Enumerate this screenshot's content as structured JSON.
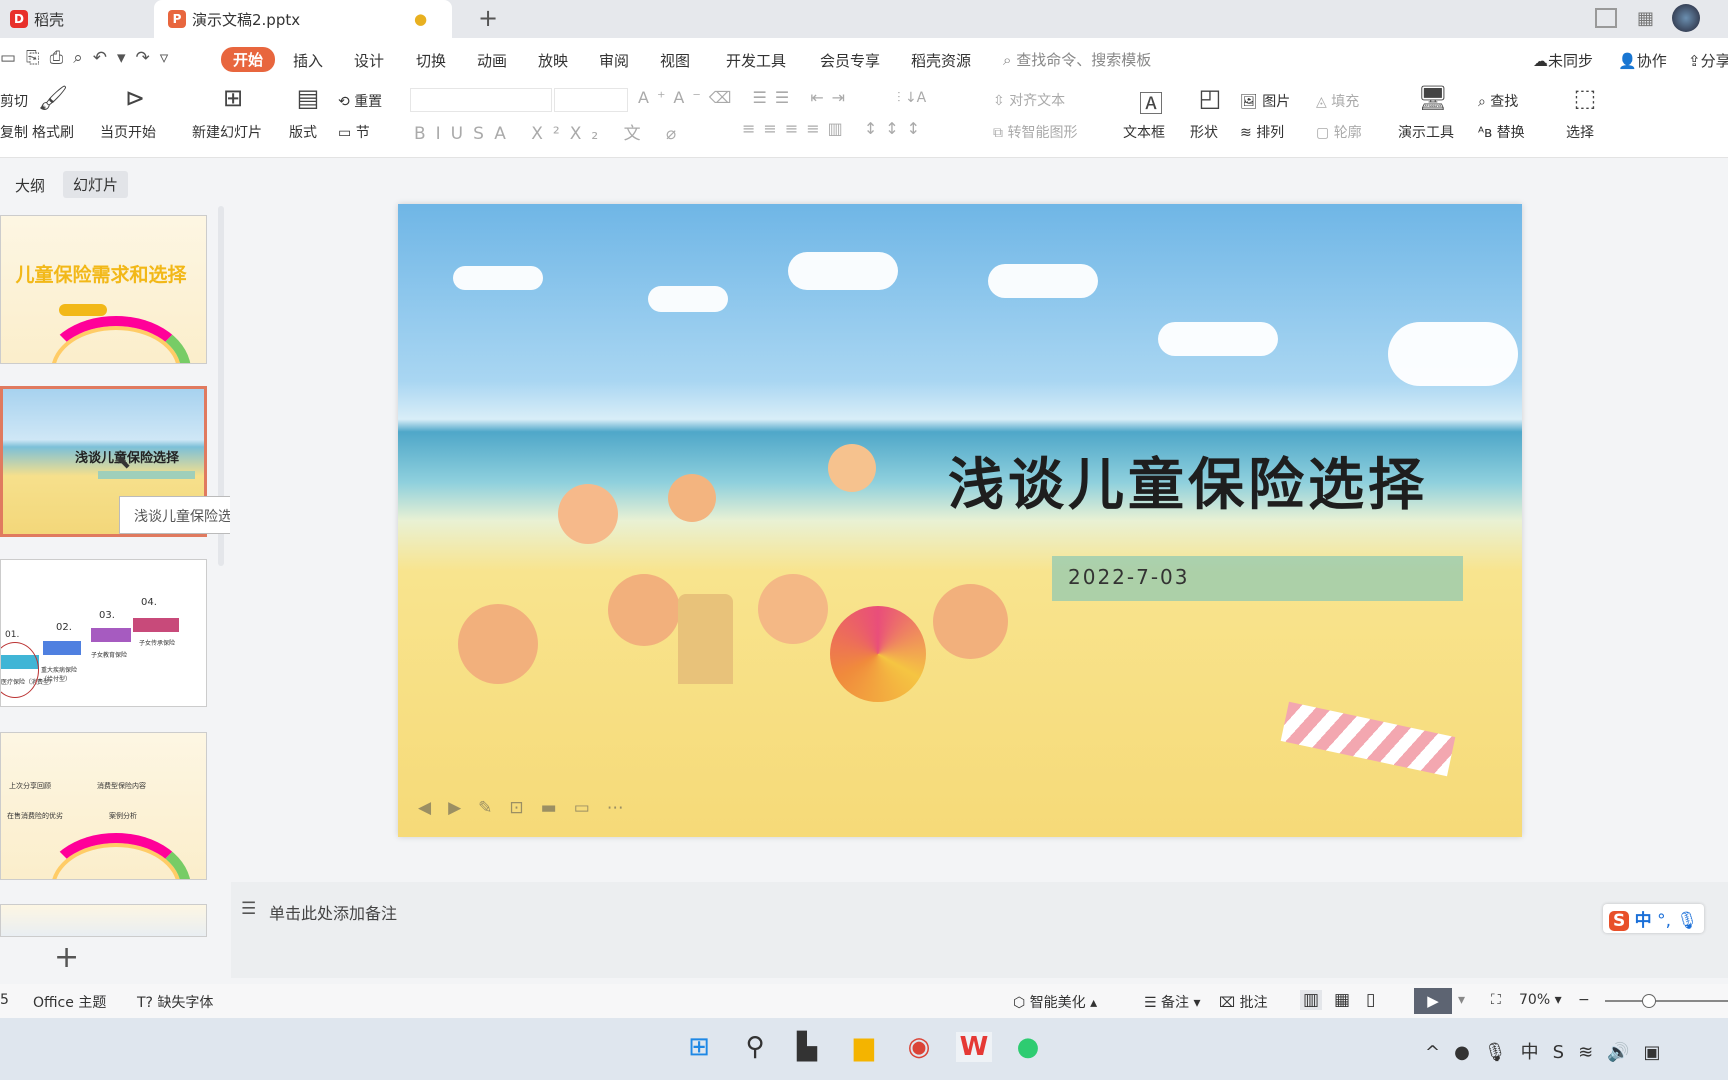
{
  "tabs": [
    {
      "label": "稻壳",
      "icon": "daoke-logo-icon"
    },
    {
      "label": "演示文稿2.pptx",
      "icon": "ppt-file-icon",
      "active": true
    }
  ],
  "menu": {
    "items": [
      "开始",
      "插入",
      "设计",
      "切换",
      "动画",
      "放映",
      "审阅",
      "视图",
      "开发工具",
      "会员专享",
      "稻壳资源"
    ],
    "active": "开始",
    "search_placeholder": "查找命令、搜索模板",
    "sync": "未同步",
    "collab": "协作",
    "share": "分享"
  },
  "ribbon": {
    "cut": "剪切",
    "copy": "复制",
    "format_painter": "格式刷",
    "play_from_current": "当页开始",
    "new_slide": "新建幻灯片",
    "layout": "版式",
    "reset": "重置",
    "section": "节",
    "align_text": "对齐文本",
    "smart_art": "转智能图形",
    "textbox": "文本框",
    "shape": "形状",
    "picture": "图片",
    "fill": "填充",
    "arrange": "排列",
    "outline": "轮廓",
    "present_tools": "演示工具",
    "find": "查找",
    "replace": "替换",
    "select": "选择"
  },
  "panel": {
    "tab_outline": "大纲",
    "tab_slides": "幻灯片",
    "tooltip": "浅谈儿童保险选择",
    "thumb1_title": "儿童保险需求和选择",
    "thumb2_title": "浅谈儿童保险选择",
    "thumb3_labels": [
      "01.",
      "02.",
      "03.",
      "04."
    ],
    "thumb3_captions": [
      "医疗保险（消费型）",
      "重大疾病保险（给付型）",
      "子女教育保险",
      "子女传承保险"
    ],
    "thumb4_items": [
      "上次分享回顾",
      "消费型保险内容",
      "在售消费险的优劣",
      "案例分析"
    ]
  },
  "slide": {
    "title": "浅谈儿童保险选择",
    "date": "2022-7-03"
  },
  "notes": {
    "placeholder": "单击此处添加备注"
  },
  "status": {
    "slide_num": "5",
    "theme": "Office 主题",
    "missing_font": "缺失字体",
    "beautify": "智能美化",
    "notes": "备注",
    "comment": "批注",
    "zoom": "70%",
    "zoom_level": 70
  },
  "ime": {
    "lang": "中"
  },
  "colors": {
    "accent": "#e8663e",
    "sel_border": "#e07a5f"
  }
}
